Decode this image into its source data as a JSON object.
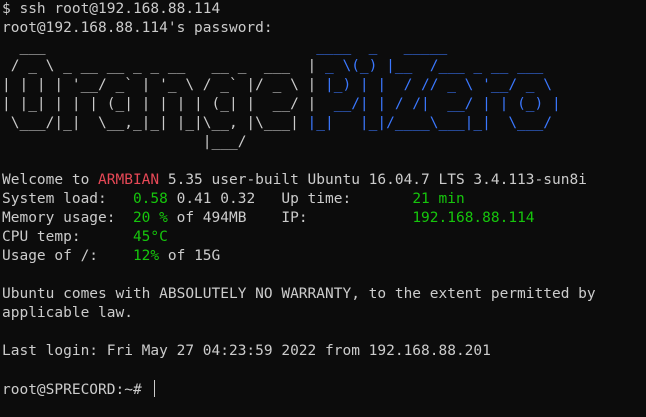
{
  "colors": {
    "background": "#0c0c0c",
    "foreground": "#cccccc",
    "red": "#e74856",
    "green": "#16c60c",
    "blue": "#3b78ff"
  },
  "session": {
    "command": "$ ssh root@192.168.88.114",
    "password_prompt": "root@192.168.88.114's password:"
  },
  "banner": {
    "line1_white": "  ___                               ",
    "line1_blue": "____  _   _____",
    "line2_white": " / _ \\ _ __ __ _ _ __   __ _  ___  |",
    "line2_blue": " _ \\(_) |__  /___ _ __ ___",
    "line3_white": "| | | | '__/ _` | '_ \\ / _` |/ _ \\ |",
    "line3_blue": " |_) | |  / // _ \\ '__/ _ \\",
    "line4_white": "| |_| | | | (_| | | | | (_| |  __/ |",
    "line4_blue": "  __/| | / /|  __/ | | (_) |",
    "line5_white": " \\___/|_|  \\__,_|_| |_|\\__, |\\___| ",
    "line5_blue": "|_|   |_|/____\\___|_|  \\___/",
    "line6_white": "                       |___/"
  },
  "motd": {
    "welcome_prefix": "Welcome to ",
    "brand": "ARMBIAN",
    "welcome_suffix": " 5.35 user-built Ubuntu 16.04.7 LTS 3.4.113-sun8i",
    "system_load_label": "System load:   ",
    "system_load_value": "0.58",
    "system_load_rest": " 0.41 0.32   Up time:       ",
    "uptime_value": "21 min",
    "memory_label": "Memory usage:  ",
    "memory_value": "20 %",
    "memory_rest": " of 494MB    IP:            ",
    "ip_value": "192.168.88.114",
    "cpu_label": "CPU temp:      ",
    "cpu_value": "45°C",
    "usage_label": "Usage of /:    ",
    "usage_value": "12%",
    "usage_rest": " of 15G"
  },
  "warranty": {
    "line1": "Ubuntu comes with ABSOLUTELY NO WARRANTY, to the extent permitted by",
    "line2": "applicable law."
  },
  "last_login": "Last login: Fri May 27 04:23:59 2022 from 192.168.88.201",
  "prompt": "root@SPRECORD:~# "
}
